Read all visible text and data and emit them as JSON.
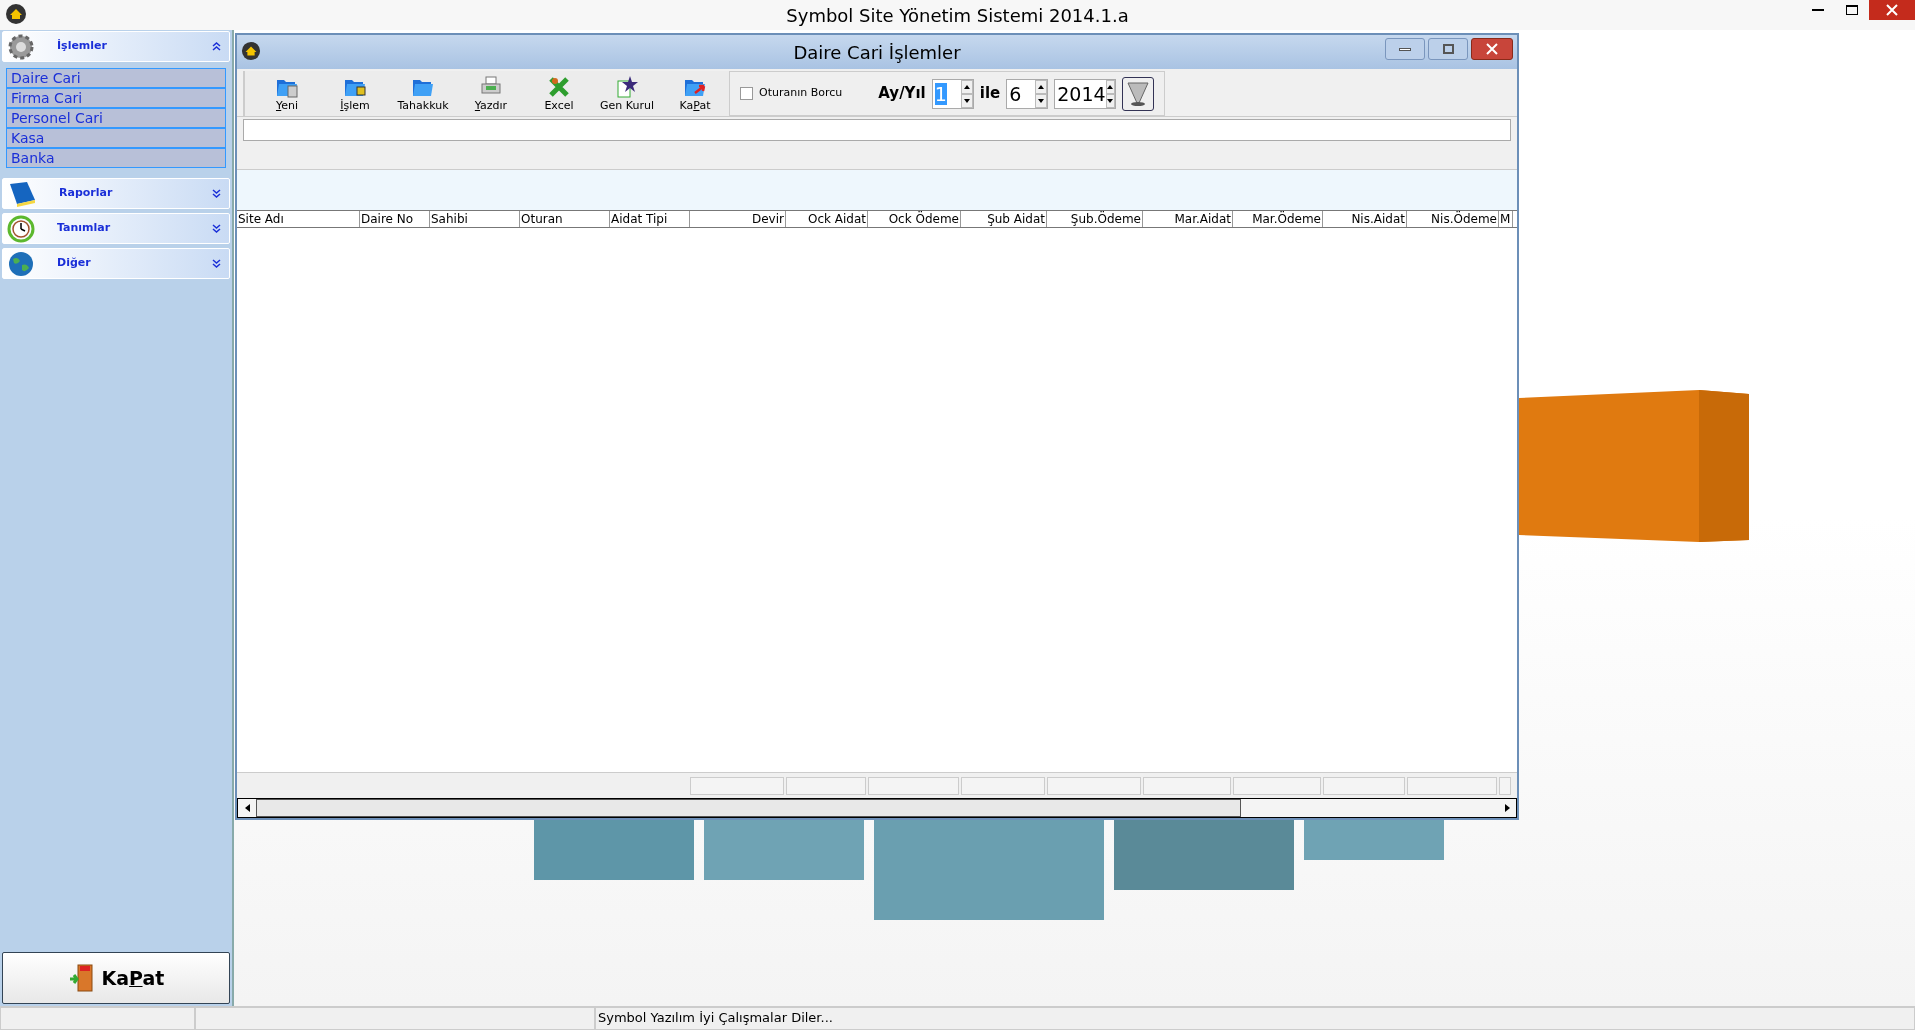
{
  "app_title": "Symbol Site Yönetim Sistemi 2014.1.a",
  "sidebar": {
    "groups": [
      {
        "kind": "gear",
        "label": "İşlemler",
        "expanded": true,
        "children": [
          {
            "label": "Daire Cari"
          },
          {
            "label": "Firma Cari"
          },
          {
            "label": "Personel Cari"
          },
          {
            "label": "Kasa"
          },
          {
            "label": "Banka"
          }
        ]
      },
      {
        "kind": "book",
        "label": "Raporlar",
        "expanded": false
      },
      {
        "kind": "clock",
        "label": "Tanımlar",
        "expanded": false
      },
      {
        "kind": "globe",
        "label": "Diğer",
        "expanded": false
      }
    ],
    "exit_button": {
      "parts": [
        {
          "text": "Ka",
          "underlined": false
        },
        {
          "text": "P",
          "underlined": true
        },
        {
          "text": "at",
          "underlined": false
        }
      ]
    }
  },
  "window": {
    "title": "Daire Cari İşlemler",
    "toolbar": [
      {
        "kind": "new",
        "parts": [
          {
            "text": "Y",
            "underlined": true
          },
          {
            "text": "eni",
            "underlined": false
          }
        ]
      },
      {
        "kind": "process",
        "parts": [
          {
            "text": "İ",
            "underlined": true
          },
          {
            "text": "şlem",
            "underlined": false
          }
        ]
      },
      {
        "kind": "accrual",
        "parts": [
          {
            "text": "Tahakkuk",
            "underlined": false
          }
        ]
      },
      {
        "kind": "print",
        "parts": [
          {
            "text": "Y",
            "underlined": true
          },
          {
            "text": "azdır",
            "underlined": false
          }
        ]
      },
      {
        "kind": "excel",
        "parts": [
          {
            "text": "Excel",
            "underlined": false
          }
        ]
      },
      {
        "kind": "meeting",
        "parts": [
          {
            "text": "Gen Kurul",
            "underlined": false
          }
        ]
      },
      {
        "kind": "close",
        "parts": [
          {
            "text": "Ka",
            "underlined": false
          },
          {
            "text": "P",
            "underlined": true
          },
          {
            "text": "at",
            "underlined": false
          }
        ]
      }
    ],
    "checkbox": {
      "label": "Oturanın Borcu",
      "checked": false
    },
    "period_label": "Ay/Yıl",
    "between_label": "ile",
    "spinners": [
      {
        "value": "1",
        "focused": true
      },
      {
        "value": "6",
        "focused": false
      },
      {
        "value": "2014",
        "focused": false
      }
    ],
    "columns": [
      "Site Adı",
      "Daire No",
      "Sahibi",
      "Oturan",
      "Aidat Tipi",
      "Devir",
      "Ock Aidat",
      "Ock Ödeme",
      "Şub Aidat",
      "Şub.Ödeme",
      "Mar.Aidat",
      "Mar.Ödeme",
      "Nis.Aidat",
      "Nis.Ödeme",
      "M"
    ]
  },
  "status_bar": {
    "message": "Symbol Yazılım İyi Çalışmalar Diler..."
  }
}
